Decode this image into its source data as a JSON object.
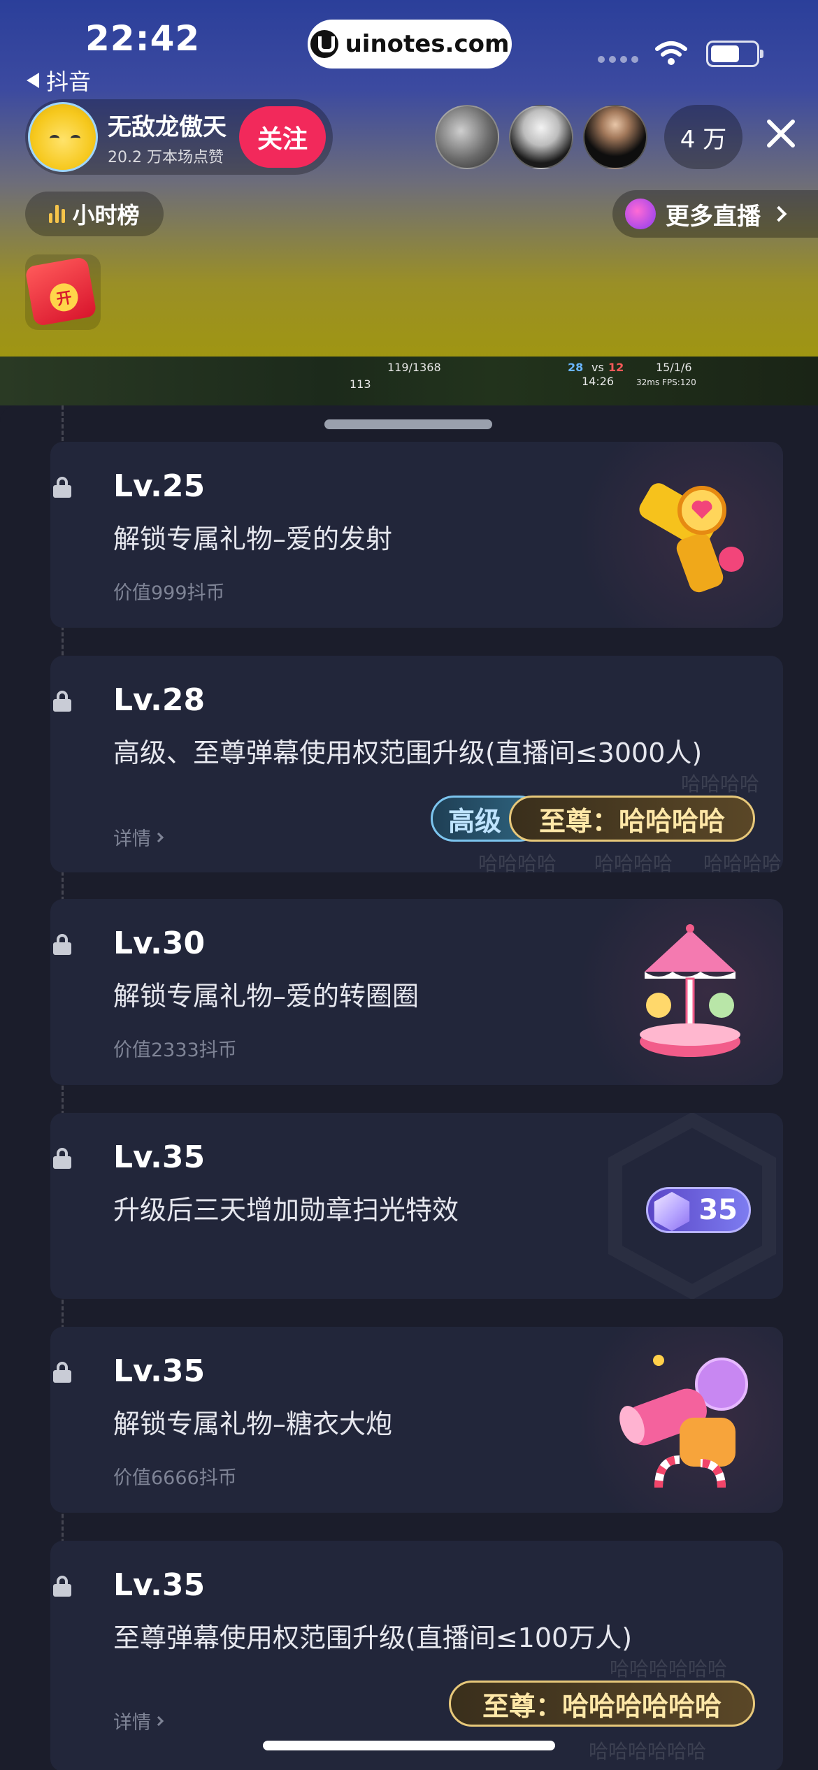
{
  "status_bar": {
    "time": "22:42",
    "back_app": "抖音",
    "url": "uinotes.com"
  },
  "host": {
    "name": "无敌龙傲天",
    "likes": "20.2 万本场点赞",
    "follow": "关注"
  },
  "viewers": {
    "count": "4 万"
  },
  "controls": {
    "hour_rank": "小时榜",
    "more_live": "更多直播",
    "redpack_glyph": "开"
  },
  "game_hud": {
    "hp": "119/1368",
    "score_blue": "28",
    "vs": "vs",
    "score_red": "12",
    "time": "14:26",
    "kda": "15/1/6",
    "fps": "32ms FPS:120",
    "gold": "113"
  },
  "levels": [
    {
      "level": "Lv.25",
      "desc": "解锁专属礼物–爱的发射",
      "value": "价值999抖币",
      "gift_icon": "love-gun-gift-icon"
    },
    {
      "level": "Lv.28",
      "desc": "高级、至尊弹幕使用权范围升级(直播间≤3000人)",
      "details": "详情",
      "pill_senior": "高级",
      "pill_supreme": "至尊：哈哈哈哈",
      "watermark": "哈哈哈哈"
    },
    {
      "level": "Lv.30",
      "desc": "解锁专属礼物–爱的转圈圈",
      "value": "价值2333抖币",
      "gift_icon": "carousel-gift-icon"
    },
    {
      "level": "Lv.35",
      "desc": "升级后三天增加勋章扫光特效",
      "badge": "35"
    },
    {
      "level": "Lv.35",
      "desc": "解锁专属礼物–糖衣大炮",
      "value": "价值6666抖币",
      "gift_icon": "candy-cannon-gift-icon"
    },
    {
      "level": "Lv.35",
      "desc": "至尊弹幕使用权范围升级(直播间≤100万人)",
      "details": "详情",
      "pill_supreme": "至尊：哈哈哈哈哈哈",
      "watermark": "哈哈哈哈哈哈"
    }
  ]
}
